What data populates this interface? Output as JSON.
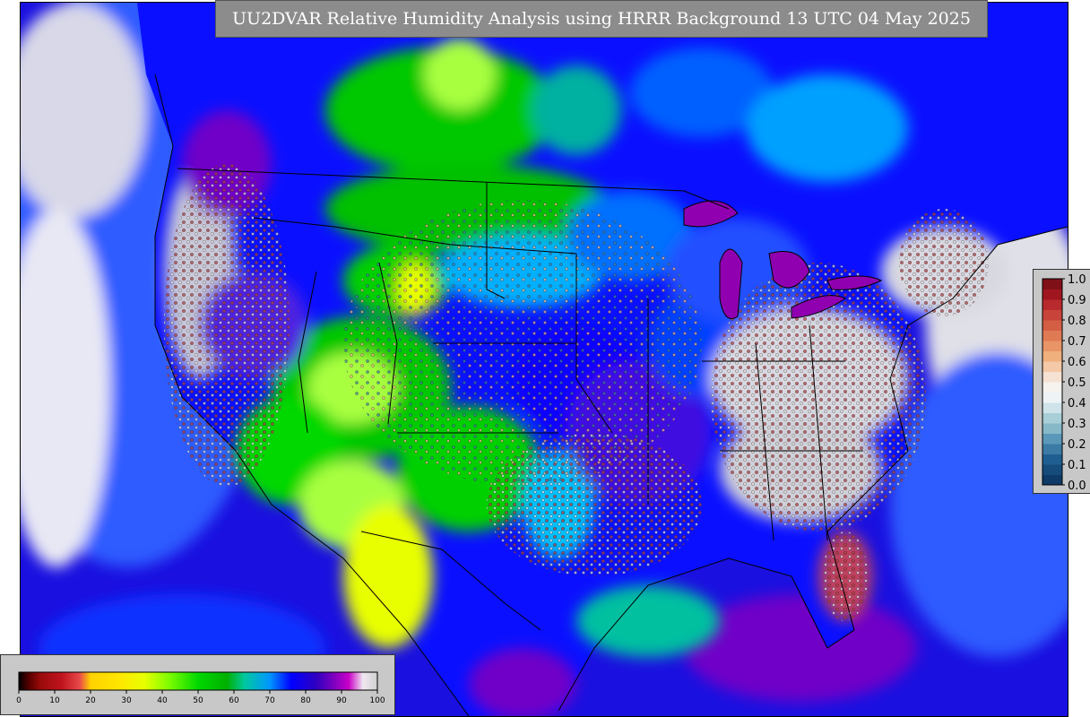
{
  "title": "UU2DVAR Relative Humidity Analysis using HRRR Background 13 UTC 04 May 2025",
  "rh_colorbar": {
    "ticks": [
      "0",
      "10",
      "20",
      "30",
      "40",
      "50",
      "60",
      "70",
      "80",
      "90",
      "100"
    ],
    "stops": [
      {
        "value": 0,
        "color": "#000000"
      },
      {
        "value": 3,
        "color": "#5a0000"
      },
      {
        "value": 6,
        "color": "#9a0a0a"
      },
      {
        "value": 12,
        "color": "#c0141e"
      },
      {
        "value": 17,
        "color": "#e84a4a"
      },
      {
        "value": 20,
        "color": "#ffd200"
      },
      {
        "value": 28,
        "color": "#ffe600"
      },
      {
        "value": 35,
        "color": "#e8ff00"
      },
      {
        "value": 42,
        "color": "#7cfc00"
      },
      {
        "value": 50,
        "color": "#00d800"
      },
      {
        "value": 58,
        "color": "#00b000"
      },
      {
        "value": 63,
        "color": "#00c8a0"
      },
      {
        "value": 70,
        "color": "#0096ff"
      },
      {
        "value": 76,
        "color": "#0000ff"
      },
      {
        "value": 83,
        "color": "#3000c0"
      },
      {
        "value": 88,
        "color": "#8000c0"
      },
      {
        "value": 92,
        "color": "#c800c8"
      },
      {
        "value": 96,
        "color": "#f0e8f0"
      },
      {
        "value": 100,
        "color": "#d0d0d0"
      }
    ]
  },
  "innovation_colorbar": {
    "ticks": [
      "0.0",
      "0.1",
      "0.2",
      "0.3",
      "0.4",
      "0.5",
      "0.6",
      "0.7",
      "0.8",
      "0.9",
      "1.0"
    ],
    "colors": [
      "#0d3a66",
      "#1c5a8a",
      "#3d7da8",
      "#6aa5c0",
      "#a3cdd8",
      "#dcecf0",
      "#f4f4f4",
      "#f6dcc8",
      "#f2b08a",
      "#e8825e",
      "#d45a44",
      "#c0302e",
      "#a01620",
      "#7a0a14",
      "#ffffff",
      "#ffffff",
      "#ffffff",
      "#ffffff",
      "#ffffff",
      "#ffffff"
    ]
  },
  "map_colors": {
    "ocean_deep": "#1a10e0",
    "ocean_mid": "#2d5cff",
    "moist": "#6000c8",
    "saturated": "#d0d0d0",
    "dry_green": "#00d000",
    "dry_yellow": "#e8ff00",
    "border": "#000000"
  }
}
